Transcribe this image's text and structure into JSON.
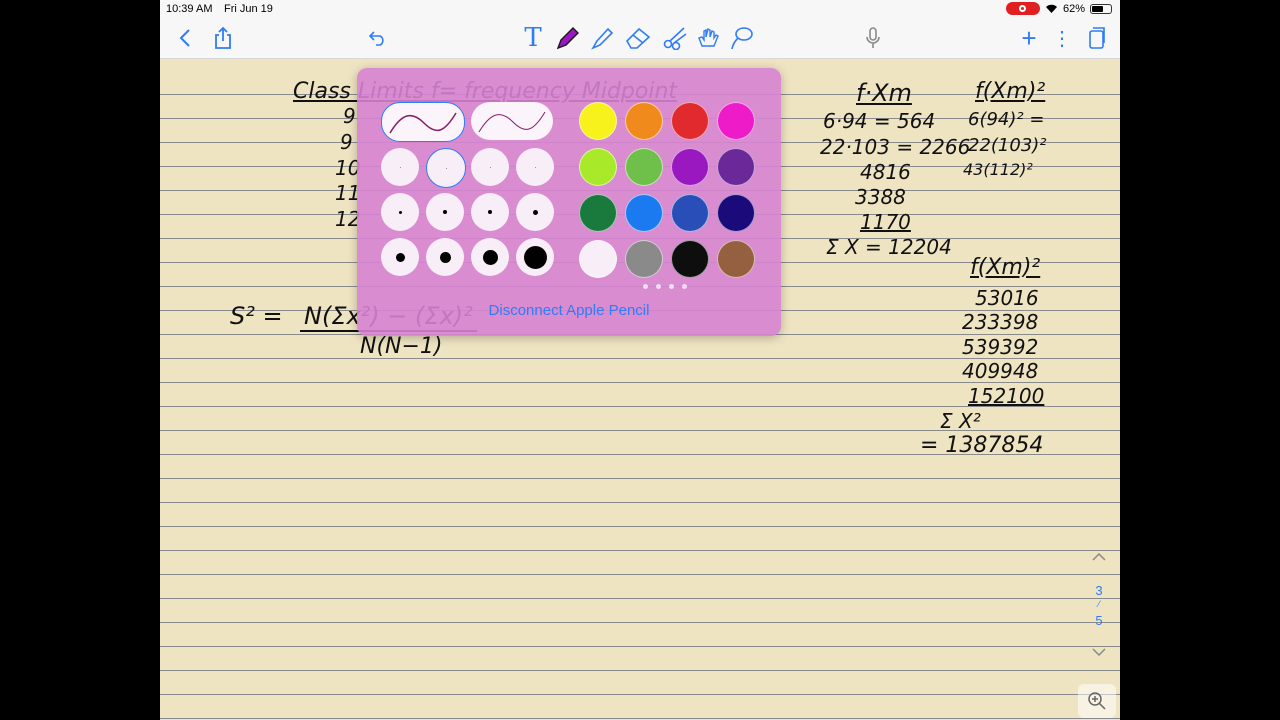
{
  "status_bar": {
    "time": "10:39 AM",
    "date": "Fri Jun 19",
    "battery": "62%"
  },
  "toolbar": {
    "back_icon": "chevron-left-icon",
    "share_icon": "share-icon",
    "undo_icon": "undo-icon",
    "text_tool": "T",
    "pen_tool": "pen-icon",
    "highlighter_tool": "highlighter-icon",
    "eraser_tool": "eraser-icon",
    "scissors_tool": "scissors-icon",
    "hand_tool": "hand-icon",
    "lasso_tool": "lasso-icon",
    "mic_icon": "microphone-icon",
    "add_label": "+",
    "more_label": "⋮",
    "pages_icon": "pages-icon"
  },
  "notes": {
    "header_left": "Class   Limits     f= frequency    Midpoint",
    "fxm_header": "f·Xm",
    "fxm_rows": [
      "6·94 = 564",
      "22·103 = 2266",
      "4816",
      "3388",
      "1170"
    ],
    "fxm_sum": "Σ X = 12204",
    "fxm2_header": "f(Xm)²",
    "fxm2_rows": [
      "6(94)² =",
      "22(103)²",
      "43(112)²"
    ],
    "fxm2_header2": "f(Xm)²",
    "fxm2_values": [
      "53016",
      "233398",
      "539392",
      "409948",
      "152100"
    ],
    "sum_x2_label": "Σ X²",
    "sum_x2_value": "= 1387854",
    "left_digits": [
      "9",
      "9",
      "10",
      "11",
      "12"
    ],
    "variance_lhs": "S² =",
    "variance_num": "N(Σx²) − (Σx)²",
    "variance_den": "N(N−1)"
  },
  "popover": {
    "colors": [
      "#f8f21c",
      "#f08a1c",
      "#e02a2e",
      "#ee1cc8",
      "#a8ea2a",
      "#6ec04a",
      "#9a18c0",
      "#6a2898",
      "#1a7a3e",
      "#1c7af0",
      "#2a4eb8",
      "#1a0a7a",
      "#f8eef8",
      "#8a8a8a",
      "#0e0e0e",
      "#946040"
    ],
    "stroke_sizes": [
      1,
      1,
      1,
      1,
      3,
      4,
      4,
      5,
      9,
      11,
      15,
      23
    ],
    "disconnect_label": "Disconnect Apple Pencil",
    "pen_stroke_color": "#8a1a6a"
  },
  "page_indicator": {
    "current": "3",
    "total": "5"
  }
}
